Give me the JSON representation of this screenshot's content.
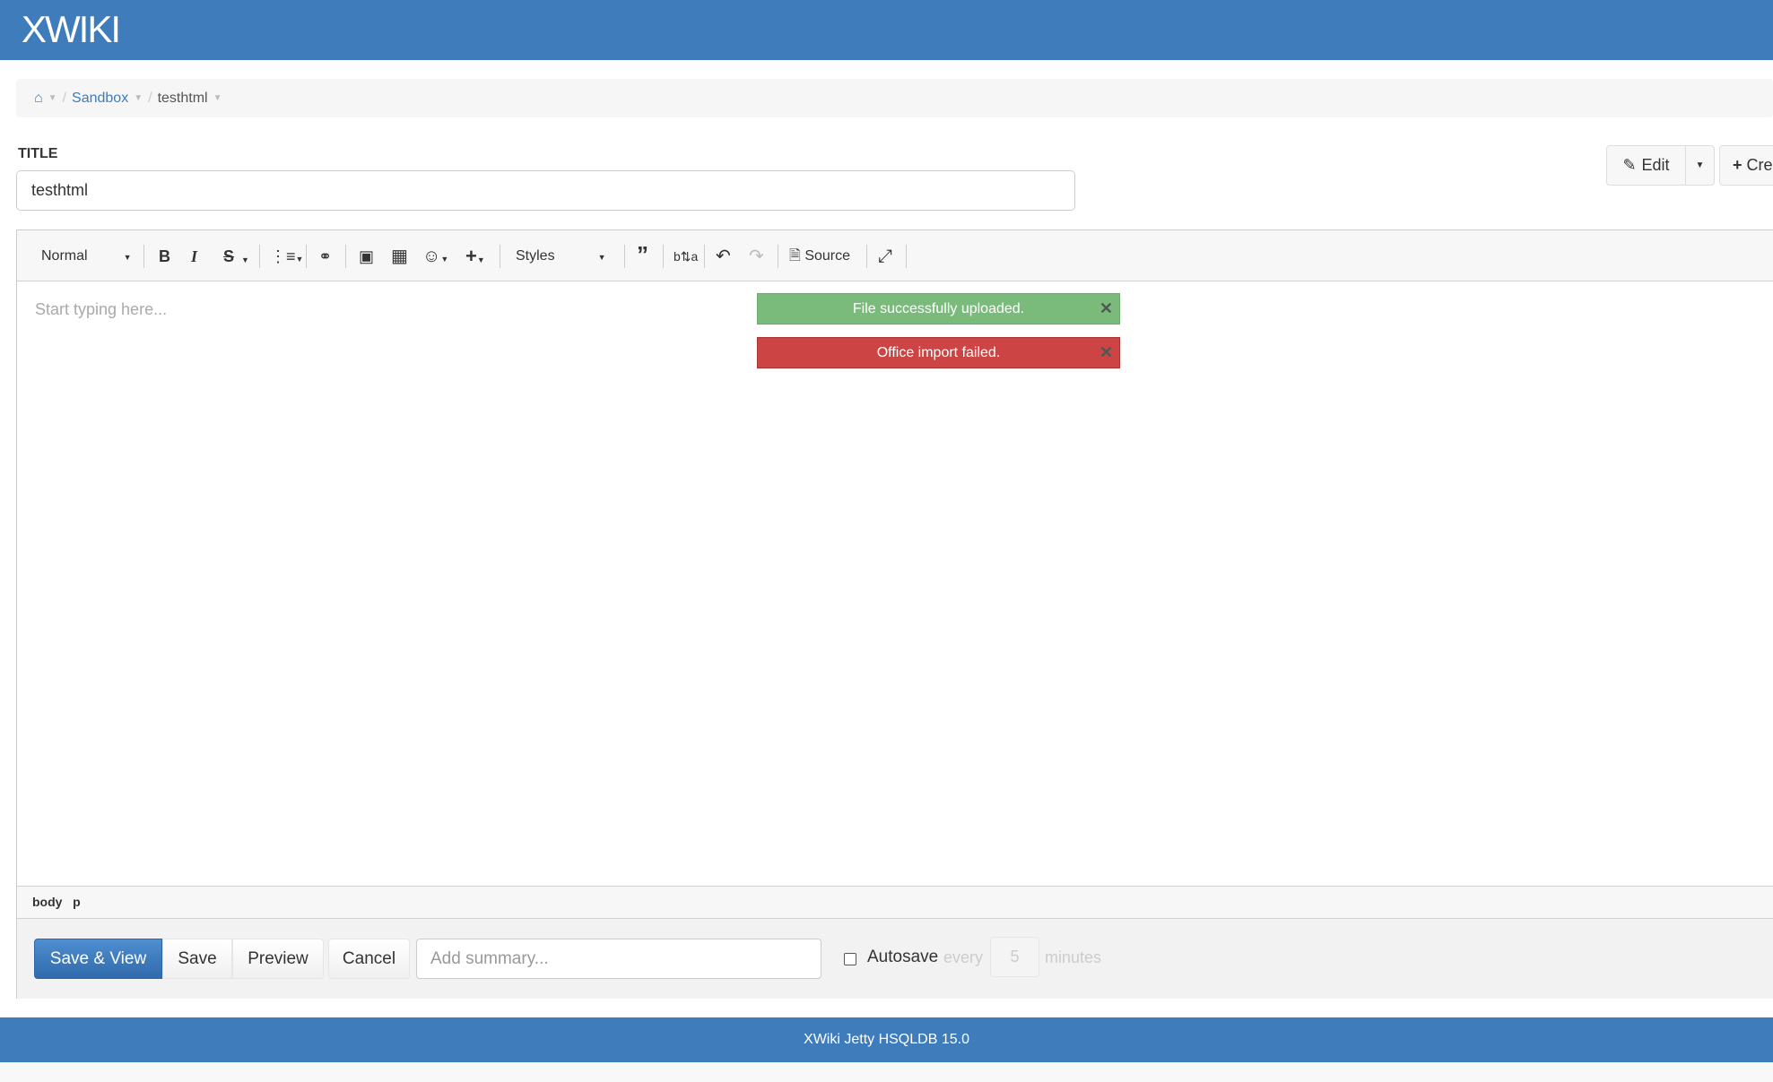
{
  "header": {
    "logo": "XWIKI"
  },
  "breadcrumb": {
    "home_icon": "home-icon",
    "items": [
      "Sandbox",
      "testhtml"
    ]
  },
  "title": {
    "label": "TITLE",
    "value": "testhtml"
  },
  "page_actions": {
    "edit": "Edit",
    "create": "Cre"
  },
  "toolbar": {
    "format": "Normal",
    "styles": "Styles",
    "source": "Source",
    "icons": [
      "bold-icon",
      "italic-icon",
      "strikethrough-icon",
      "bulleted-list-icon",
      "link-icon",
      "image-icon",
      "table-icon",
      "emoji-icon",
      "plus-icon",
      "blockquote-icon",
      "text-direction-icon",
      "undo-icon",
      "redo-icon",
      "source-icon",
      "maximize-icon"
    ],
    "bold": "B",
    "italic": "I",
    "strike": "S"
  },
  "editor": {
    "placeholder": "Start typing here...",
    "path": [
      "body",
      "p"
    ]
  },
  "notifications": [
    {
      "text": "File successfully uploaded.",
      "color": "#7aba7b"
    },
    {
      "text": "Office import failed.",
      "color": "#cc4444"
    }
  ],
  "actions": {
    "save_view": "Save & View",
    "save": "Save",
    "preview": "Preview",
    "cancel": "Cancel",
    "summary_placeholder": "Add summary...",
    "autosave": "Autosave",
    "every": "every",
    "minutes_value": "5",
    "minutes": "minutes"
  },
  "footer": {
    "text": "XWiki Jetty HSQLDB 15.0"
  }
}
